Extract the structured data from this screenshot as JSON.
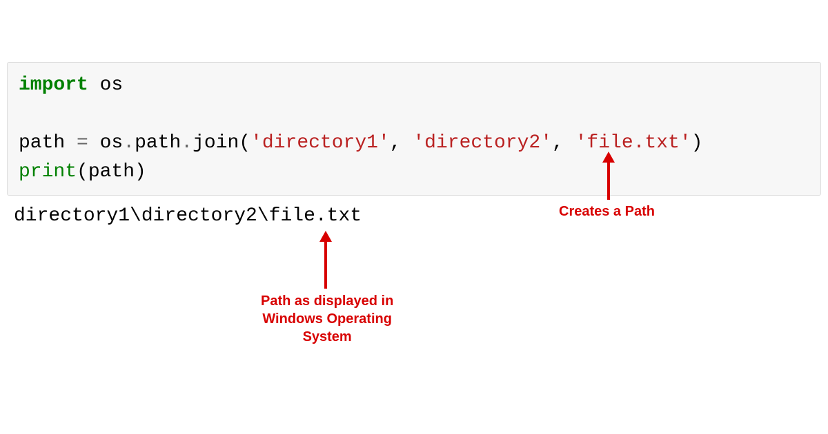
{
  "code": {
    "line1_keyword": "import",
    "line1_module": " os",
    "line2_var": "path ",
    "line2_op1": "=",
    "line2_expr1": " os",
    "line2_op2": ".",
    "line2_expr2": "path",
    "line2_op3": ".",
    "line2_expr3": "join(",
    "line2_str1": "'directory1'",
    "line2_comma1": ", ",
    "line2_str2": "'directory2'",
    "line2_comma2": ", ",
    "line2_str3": "'file.txt'",
    "line2_close": ")",
    "line3_fn": "print",
    "line3_open": "(path)"
  },
  "output": "directory1\\directory2\\file.txt",
  "annotations": {
    "creates_path": "Creates a Path",
    "path_displayed": "Path as displayed in\nWindows Operating\nSystem"
  }
}
